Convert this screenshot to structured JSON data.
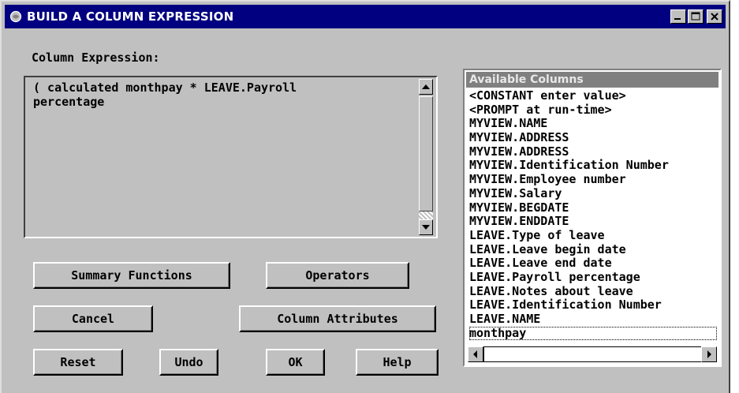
{
  "window": {
    "title": "BUILD A COLUMN EXPRESSION",
    "icons": {
      "app": "sas-icon",
      "minimize": "minimize-icon",
      "maximize": "maximize-icon",
      "close": "close-icon"
    }
  },
  "expression": {
    "label": "Column Expression:",
    "value": "( calculated monthpay * LEAVE.Payroll\npercentage"
  },
  "buttons": {
    "summary_functions": "Summary Functions",
    "operators": "Operators",
    "cancel": "Cancel",
    "column_attributes": "Column Attributes",
    "reset": "Reset",
    "undo": "Undo",
    "ok": "OK",
    "help": "Help"
  },
  "available_columns": {
    "header": "Available Columns",
    "items": [
      "<CONSTANT enter value>",
      "<PROMPT at run-time>",
      "MYVIEW.NAME",
      "MYVIEW.ADDRESS",
      "MYVIEW.ADDRESS",
      "MYVIEW.Identification Number",
      "MYVIEW.Employee number",
      "MYVIEW.Salary",
      "MYVIEW.BEGDATE",
      "MYVIEW.ENDDATE",
      "LEAVE.Type of leave",
      "LEAVE.Leave begin date",
      "LEAVE.Leave end date",
      "LEAVE.Payroll percentage",
      "LEAVE.Notes about leave",
      "LEAVE.Identification Number",
      "LEAVE.NAME",
      "monthpay"
    ],
    "selected": "monthpay"
  },
  "colors": {
    "title_bar": "#000080",
    "window_face": "#c0c0c0",
    "list_header": "#808080"
  }
}
